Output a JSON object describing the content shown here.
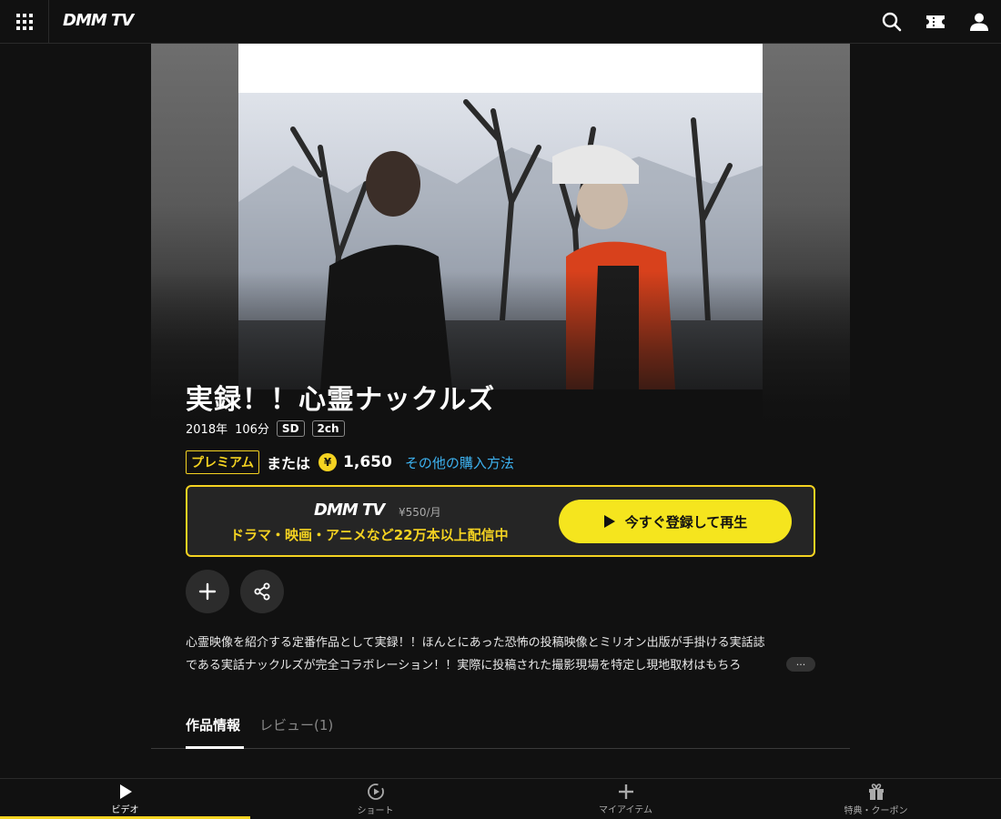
{
  "header": {
    "logo": "DMM TV",
    "icons": [
      "grid-menu-icon",
      "search-icon",
      "ticket-icon",
      "user-icon"
    ]
  },
  "title": {
    "text": "実録！！心霊ナックルズ",
    "year": "2018年",
    "duration": "106分",
    "tags": [
      "SD",
      "2ch"
    ]
  },
  "pricing": {
    "premium_label": "プレミアム",
    "or_label": "または",
    "yen_icon": "¥",
    "price": "1,650",
    "other_purchase_link": "その他の購入方法"
  },
  "promo": {
    "logo": "DMM TV",
    "price_text": "¥550/月",
    "copy": "ドラマ・映画・アニメなど22万本以上配信中",
    "cta_label": "今すぐ登録して再生"
  },
  "description": {
    "line1": "心霊映像を紹介する定番作品として実録！！ほんとにあった恐怖の投稿映像とミリオン出版が手掛ける実話誌",
    "line2": "である実話ナックルズが完全コラボレーション！！実際に投稿された撮影現場を特定し現地取材はもちろ",
    "more_label": "···"
  },
  "tabs": [
    {
      "label": "作品情報",
      "active": true
    },
    {
      "label": "レビュー(1)",
      "active": false
    }
  ],
  "bottom_nav": [
    {
      "label": "ビデオ",
      "icon": "play-icon",
      "active": true
    },
    {
      "label": "ショート",
      "icon": "short-play-icon",
      "active": false
    },
    {
      "label": "マイアイテム",
      "icon": "plus-icon",
      "active": false
    },
    {
      "label": "特典・クーポン",
      "icon": "gift-icon",
      "active": false
    }
  ],
  "colors": {
    "accent": "#f5d321",
    "link": "#3db2f0",
    "background": "#111111"
  }
}
